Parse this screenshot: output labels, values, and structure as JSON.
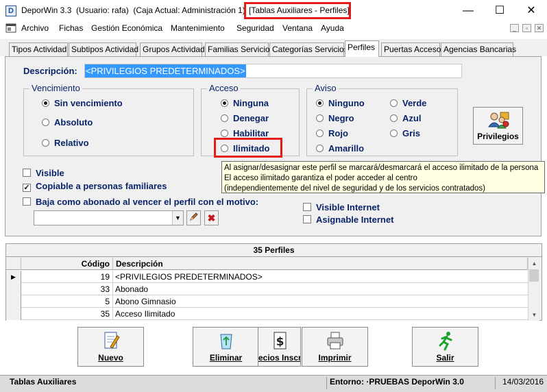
{
  "window": {
    "title": "DeporWin 3.3  (Usuario: rafa)  (Caja Actual: Administración 1)",
    "title_highlight": "[Tablas Auxiliares - Perfiles]",
    "app_icon_letter": "D",
    "minimize": "—",
    "maximize": "☐",
    "close": "✕"
  },
  "menu": {
    "items": [
      "Archivo",
      "Fichas",
      "Gestión Económica",
      "Mantenimiento",
      "Seguridad",
      "Ventana",
      "Ayuda"
    ],
    "underline": [
      "A",
      "F",
      "G",
      "M",
      "S",
      "V",
      "y"
    ]
  },
  "tabs": [
    "Tipos Actividad",
    "Subtipos Actividad",
    "Grupos Actividad",
    "Familias Servicios",
    "Categorías Servicios",
    "Perfiles",
    "Puertas Acceso",
    "Agencias Bancarias"
  ],
  "active_tab": "Perfiles",
  "form": {
    "descripcion_label": "Descripción:",
    "descripcion_value": "<PRIVILEGIOS PREDETERMINADOS>",
    "vencimiento": {
      "title": "Vencimiento",
      "options": [
        "Sin vencimiento",
        "Absoluto",
        "Relativo"
      ],
      "selected": "Sin vencimiento"
    },
    "acceso": {
      "title": "Acceso",
      "options": [
        "Ninguna",
        "Denegar",
        "Habilitar",
        "Ilimitado"
      ],
      "selected": "Ninguna"
    },
    "aviso": {
      "title": "Aviso",
      "options": [
        "Ninguno",
        "Negro",
        "Rojo",
        "Amarillo",
        "Verde",
        "Azul",
        "Gris"
      ],
      "selected": "Ninguno"
    },
    "privilegios_button": "Privilegios",
    "visible_label": "Visible",
    "visible_checked": false,
    "copiable_label": "Copiable a personas familiares",
    "copiable_checked": true,
    "baja_label": "Baja como abonado al vencer el perfil con el motivo:",
    "baja_checked": false,
    "motivo_value": "",
    "visible_internet_label": "Visible Internet",
    "visible_internet_checked": false,
    "asignable_internet_label": "Asignable Internet",
    "asignable_internet_checked": false
  },
  "tooltip": [
    "Al asignar/desasignar este perfil se marcará/desmarcará el acceso ilimitado de la persona",
    "El acceso ilimitado garantiza el poder acceder al centro",
    "(independientemente del nivel de seguridad y de los servicios contratados)"
  ],
  "grid": {
    "title": "35 Perfiles",
    "headers": [
      "Código",
      "Descripción"
    ],
    "rows": [
      {
        "codigo": "19",
        "descripcion": "<PRIVILEGIOS PREDETERMINADOS>",
        "current": true
      },
      {
        "codigo": "33",
        "descripcion": "Abonado",
        "current": false
      },
      {
        "codigo": "5",
        "descripcion": "Abono Gimnasio",
        "current": false
      },
      {
        "codigo": "35",
        "descripcion": "Acceso Ilimitado",
        "current": false
      }
    ]
  },
  "buttons": [
    "Nuevo",
    "Eliminar",
    "ecios Inscri",
    "Imprimir",
    "Salir"
  ],
  "status": {
    "left": "Tablas Auxiliares",
    "entorno": "Entorno: ·PRUEBAS DeporWin 3.0",
    "date": "14/03/2016"
  },
  "colors": {
    "highlight_red": "#e31b1b",
    "selection_blue": "#3399ff",
    "label_navy": "#0a246a",
    "tooltip_bg": "#ffffe1"
  },
  "icons": [
    "app-icon",
    "privilegios-icon",
    "edit-icon",
    "delete-icon",
    "new-icon",
    "recycle-bin-icon",
    "prices-icon",
    "printer-icon",
    "exit-runner-icon"
  ]
}
